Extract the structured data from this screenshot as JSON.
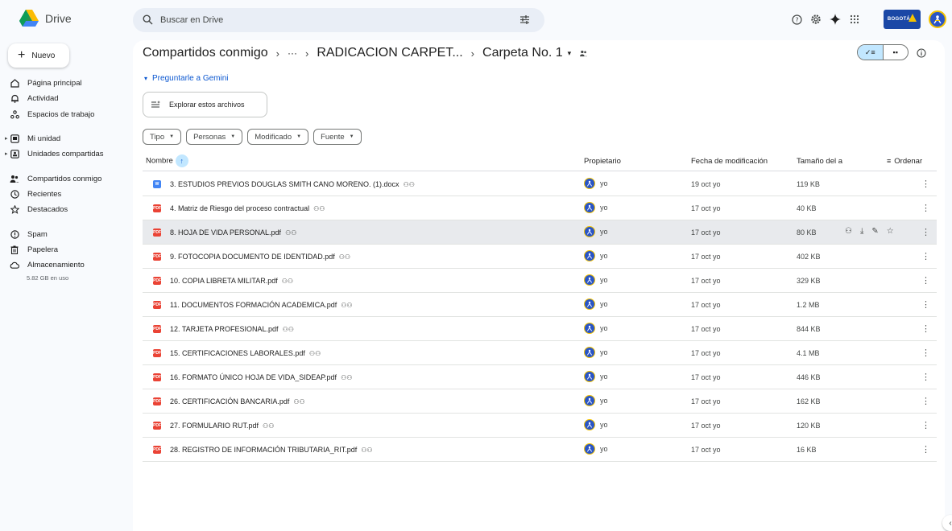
{
  "app": {
    "name": "Drive",
    "search_placeholder": "Buscar en Drive",
    "org_logo_text": "BOGOTÁ"
  },
  "sidebar": {
    "new_label": "Nuevo",
    "items": [
      {
        "label": "Página principal",
        "icon": "home-icon"
      },
      {
        "label": "Actividad",
        "icon": "bell-icon"
      },
      {
        "label": "Espacios de trabajo",
        "icon": "workspaces-icon"
      },
      {
        "label": "Mi unidad",
        "icon": "my-drive-icon"
      },
      {
        "label": "Unidades compartidas",
        "icon": "shared-drives-icon"
      },
      {
        "label": "Compartidos conmigo",
        "icon": "people-icon"
      },
      {
        "label": "Recientes",
        "icon": "clock-icon"
      },
      {
        "label": "Destacados",
        "icon": "star-icon"
      },
      {
        "label": "Spam",
        "icon": "spam-icon"
      },
      {
        "label": "Papelera",
        "icon": "trash-icon"
      },
      {
        "label": "Almacenamiento",
        "icon": "cloud-icon"
      }
    ],
    "storage_used": "5.82 GB en uso"
  },
  "breadcrumb": {
    "root": "Compartidos conmigo",
    "ellipsis": "···",
    "middle": "RADICACION CARPET...",
    "current": "Carpeta No. 1"
  },
  "gemini": {
    "ask_label": "Preguntarle a Gemini",
    "explore_label": "Explorar estos archivos"
  },
  "filters": [
    "Tipo",
    "Personas",
    "Modificado",
    "Fuente"
  ],
  "columns": {
    "name": "Nombre",
    "owner": "Propietario",
    "modified": "Fecha de modificación",
    "size": "Tamaño del a",
    "sort": "Ordenar"
  },
  "files": [
    {
      "type": "docx",
      "badge": "W",
      "name": "3. ESTUDIOS PREVIOS DOUGLAS SMITH CANO MORENO. (1).docx",
      "owner": "yo",
      "modified": "19 oct yo",
      "size": "119 KB"
    },
    {
      "type": "pdf",
      "badge": "PDF",
      "name": "4. Matriz de Riesgo del proceso contractual",
      "owner": "yo",
      "modified": "17 oct yo",
      "size": "40 KB"
    },
    {
      "type": "pdf",
      "badge": "PDF",
      "name": "8. HOJA DE VIDA PERSONAL.pdf",
      "owner": "yo",
      "modified": "17 oct yo",
      "size": "80 KB"
    },
    {
      "type": "pdf",
      "badge": "PDF",
      "name": "9. FOTOCOPIA DOCUMENTO DE IDENTIDAD.pdf",
      "owner": "yo",
      "modified": "17 oct yo",
      "size": "402 KB"
    },
    {
      "type": "pdf",
      "badge": "PDF",
      "name": "10. COPIA LIBRETA MILITAR.pdf",
      "owner": "yo",
      "modified": "17 oct yo",
      "size": "329 KB"
    },
    {
      "type": "pdf",
      "badge": "PDF",
      "name": "11. DOCUMENTOS FORMACIÓN ACADEMICA.pdf",
      "owner": "yo",
      "modified": "17 oct yo",
      "size": "1.2 MB"
    },
    {
      "type": "pdf",
      "badge": "PDF",
      "name": "12. TARJETA PROFESIONAL.pdf",
      "owner": "yo",
      "modified": "17 oct yo",
      "size": "844 KB"
    },
    {
      "type": "pdf",
      "badge": "PDF",
      "name": "15. CERTIFICACIONES LABORALES.pdf",
      "owner": "yo",
      "modified": "17 oct yo",
      "size": "4.1 MB"
    },
    {
      "type": "pdf",
      "badge": "PDF",
      "name": "16. FORMATO ÚNICO HOJA DE VIDA_SIDEAP.pdf",
      "owner": "yo",
      "modified": "17 oct yo",
      "size": "446 KB"
    },
    {
      "type": "pdf",
      "badge": "PDF",
      "name": "26. CERTIFICACIÓN BANCARIA.pdf",
      "owner": "yo",
      "modified": "17 oct yo",
      "size": "162 KB"
    },
    {
      "type": "pdf",
      "badge": "PDF",
      "name": "27. FORMULARIO RUT.pdf",
      "owner": "yo",
      "modified": "17 oct yo",
      "size": "120 KB"
    },
    {
      "type": "pdf",
      "badge": "PDF",
      "name": "28. REGISTRO DE INFORMACIÓN TRIBUTARIA_RIT.pdf",
      "owner": "yo",
      "modified": "17 oct yo",
      "size": "16 KB"
    }
  ],
  "selected_row": 2,
  "colors": {
    "accent": "#0b57d0",
    "selected_chip": "#c2e7ff",
    "pdf_red": "#ea4335",
    "doc_blue": "#4285f4",
    "background": "#f8fafd"
  }
}
